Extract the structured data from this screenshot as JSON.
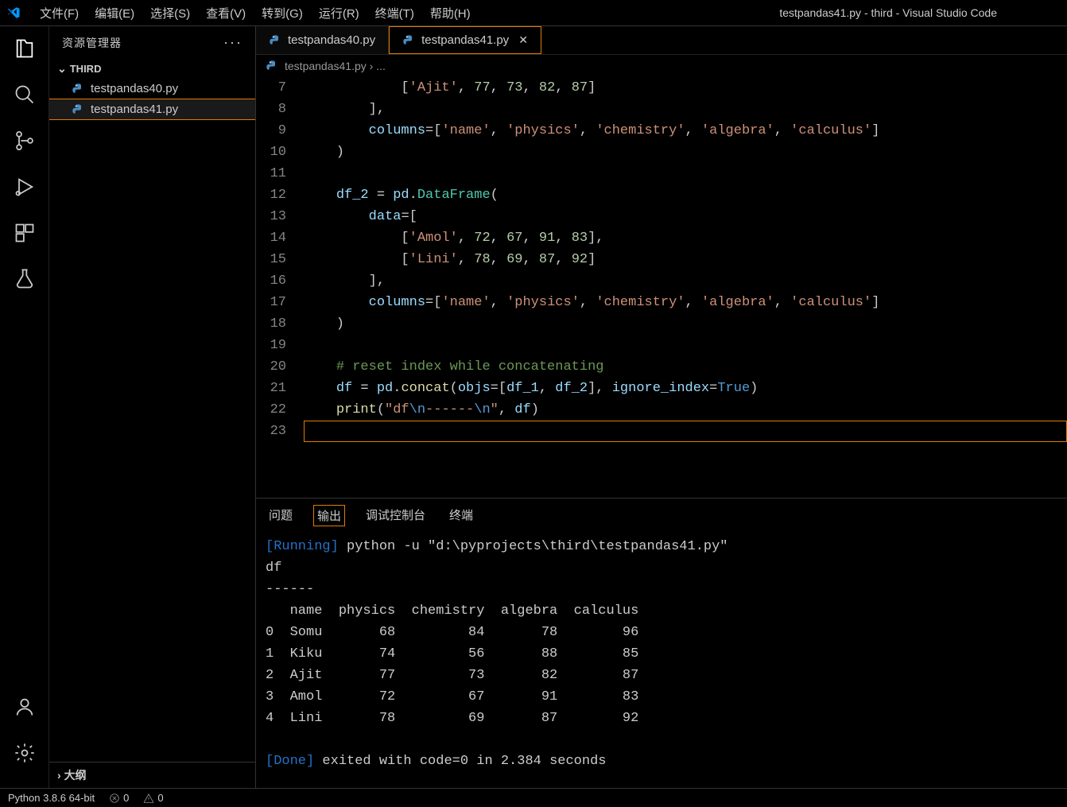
{
  "window_title": "testpandas41.py - third - Visual Studio Code",
  "menu": [
    "文件(F)",
    "编辑(E)",
    "选择(S)",
    "查看(V)",
    "转到(G)",
    "运行(R)",
    "终端(T)",
    "帮助(H)"
  ],
  "sidebar": {
    "title": "资源管理器",
    "folder": "THIRD",
    "files": [
      "testpandas40.py",
      "testpandas41.py"
    ],
    "outline": "大纲"
  },
  "tabs": [
    {
      "label": "testpandas40.py",
      "active": false
    },
    {
      "label": "testpandas41.py",
      "active": true
    }
  ],
  "breadcrumb": {
    "file": "testpandas41.py",
    "trail": "..."
  },
  "editor": {
    "first_line": 7,
    "lines": [
      {
        "n": 7,
        "html": "            [<span class='tok-str'>'Ajit'</span>, <span class='tok-num'>77</span>, <span class='tok-num'>73</span>, <span class='tok-num'>82</span>, <span class='tok-num'>87</span>]"
      },
      {
        "n": 8,
        "html": "        ],"
      },
      {
        "n": 9,
        "html": "        <span class='tok-var'>columns</span>=[<span class='tok-str'>'name'</span>, <span class='tok-str'>'physics'</span>, <span class='tok-str'>'chemistry'</span>, <span class='tok-str'>'algebra'</span>, <span class='tok-str'>'calculus'</span>]"
      },
      {
        "n": 10,
        "html": "    )"
      },
      {
        "n": 11,
        "html": ""
      },
      {
        "n": 12,
        "html": "    <span class='tok-var'>df_2</span> <span class='tok-op'>=</span> <span class='tok-var'>pd</span>.<span class='tok-type'>DataFrame</span>("
      },
      {
        "n": 13,
        "html": "        <span class='tok-var'>data</span>=["
      },
      {
        "n": 14,
        "html": "            [<span class='tok-str'>'Amol'</span>, <span class='tok-num'>72</span>, <span class='tok-num'>67</span>, <span class='tok-num'>91</span>, <span class='tok-num'>83</span>],"
      },
      {
        "n": 15,
        "html": "            [<span class='tok-str'>'Lini'</span>, <span class='tok-num'>78</span>, <span class='tok-num'>69</span>, <span class='tok-num'>87</span>, <span class='tok-num'>92</span>]"
      },
      {
        "n": 16,
        "html": "        ],"
      },
      {
        "n": 17,
        "html": "        <span class='tok-var'>columns</span>=[<span class='tok-str'>'name'</span>, <span class='tok-str'>'physics'</span>, <span class='tok-str'>'chemistry'</span>, <span class='tok-str'>'algebra'</span>, <span class='tok-str'>'calculus'</span>]"
      },
      {
        "n": 18,
        "html": "    )"
      },
      {
        "n": 19,
        "html": ""
      },
      {
        "n": 20,
        "html": "    <span class='tok-comment'># reset index while concatenating</span>"
      },
      {
        "n": 21,
        "html": "    <span class='tok-var'>df</span> <span class='tok-op'>=</span> <span class='tok-var'>pd</span>.<span class='tok-func'>concat</span>(<span class='tok-var'>objs</span>=[<span class='tok-var'>df_1</span>, <span class='tok-var'>df_2</span>], <span class='tok-var'>ignore_index</span>=<span class='tok-const'>True</span>)"
      },
      {
        "n": 22,
        "html": "    <span class='tok-func'>print</span>(<span class='tok-str'>\"df<span class='tok-kw'>\\n</span>------<span class='tok-kw'>\\n</span>\"</span>, <span class='tok-var'>df</span>)"
      },
      {
        "n": 23,
        "html": "",
        "cursor": true
      }
    ]
  },
  "panel": {
    "tabs": [
      "问题",
      "输出",
      "调试控制台",
      "终端"
    ],
    "active_tab": 1,
    "running_label": "[Running]",
    "command": " python -u \"d:\\pyprojects\\third\\testpandas41.py\"",
    "header_line": "df",
    "sep_line": "------",
    "columns_line": "   name  physics  chemistry  algebra  calculus",
    "rows": [
      "0  Somu       68         84       78        96",
      "1  Kiku       74         56       88        85",
      "2  Ajit       77         73       82        87",
      "3  Amol       72         67       91        83",
      "4  Lini       78         69       87        92"
    ],
    "done_label": "[Done]",
    "done_rest": " exited with code=0 in 2.384 seconds"
  },
  "status": {
    "python": "Python 3.8.6 64-bit",
    "errors": "0",
    "warnings": "0"
  }
}
